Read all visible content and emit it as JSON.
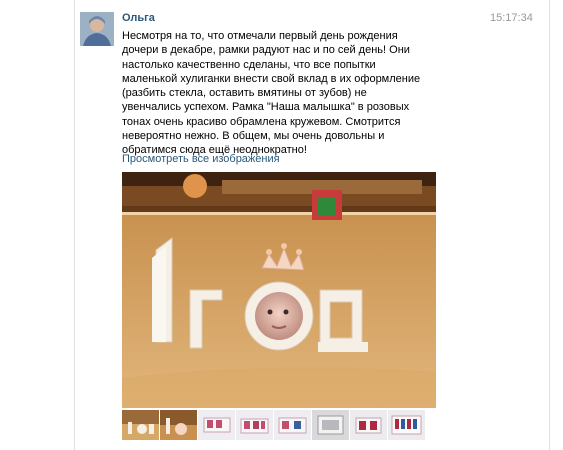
{
  "post": {
    "author": "Ольга",
    "time": "15:17:34",
    "text": "Несмотря на то, что отмечали первый день рождения дочери в декабре, рамки радуют нас и по сей день! Они настолько качественно сделаны, что все попытки маленькой хулиганки внести свой вклад в их оформление (разбить стекла, оставить вмятины от зубов) не увенчались успехом. Рамка \"Наша малышка\" в розовых тонах очень красиво обрамлена кружевом. Смотрится невероятно нежно. В общем, мы очень довольны и обратимся сюда ещё неоднократно!",
    "view_all_label": "Просмотреть все изображения",
    "main_photo": {
      "description_icon": "photo-1-god-frame",
      "frame_letters": [
        "1",
        "Г",
        "Д"
      ]
    },
    "thumbnails": [
      {
        "icon": "thumb-1-god-wood"
      },
      {
        "icon": "thumb-1-god-pink"
      },
      {
        "icon": "thumb-frame-pink"
      },
      {
        "icon": "thumb-frame-pink-2"
      },
      {
        "icon": "thumb-frame-pink-3"
      },
      {
        "icon": "thumb-frame-white"
      },
      {
        "icon": "thumb-frame-red"
      },
      {
        "icon": "thumb-frame-letters"
      }
    ]
  },
  "colors": {
    "link": "#2b587a",
    "time": "#999999"
  }
}
